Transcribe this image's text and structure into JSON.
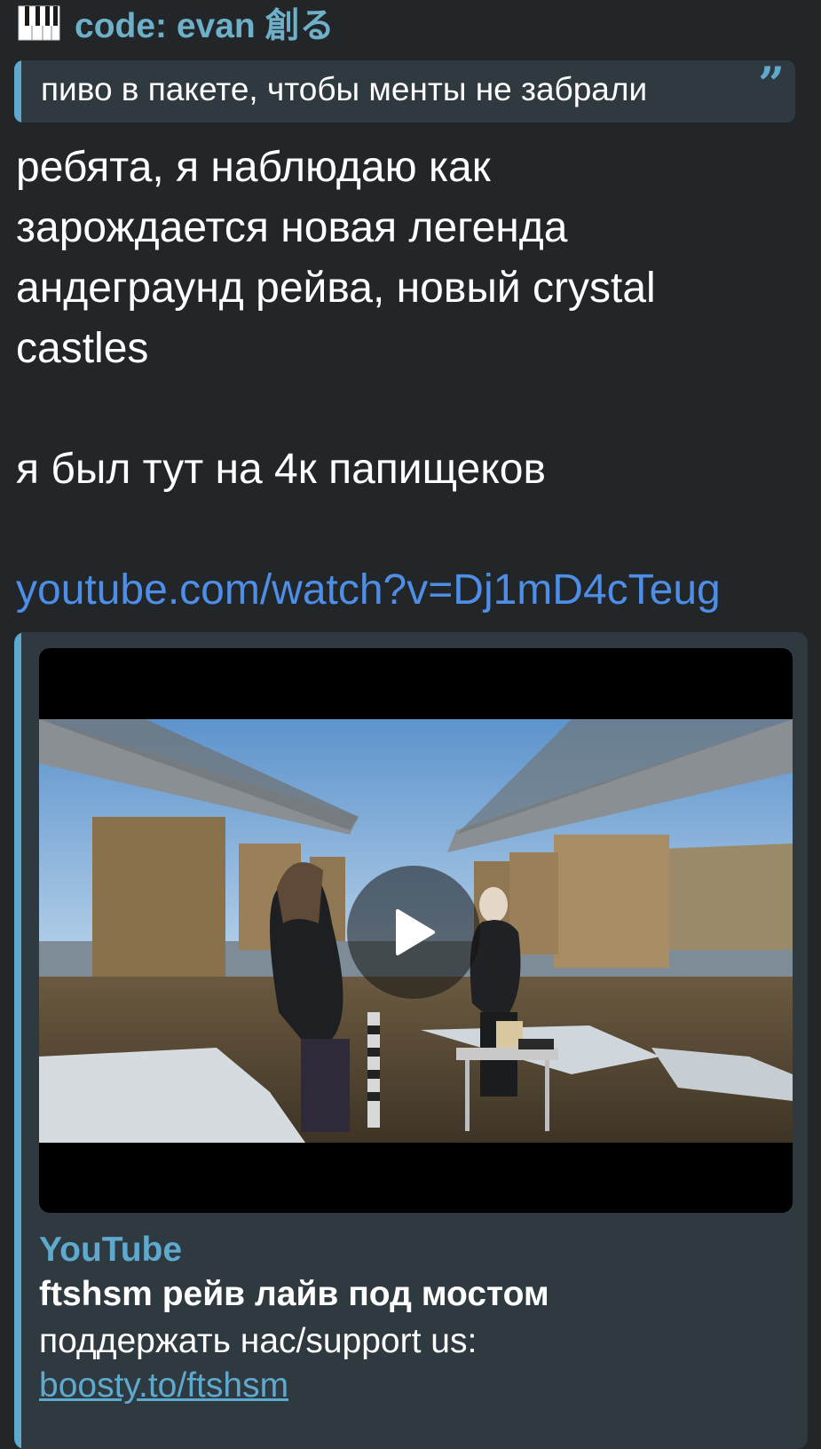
{
  "sender": {
    "name": "code: evan 創る",
    "icon": "piano-icon"
  },
  "reply": {
    "text": "пиво в пакете, чтобы менты не забрали",
    "icon": "quote-icon",
    "accent": "#5fa9cf"
  },
  "message": {
    "lines": [
      "ребята, я наблюдаю как",
      "зарождается новая легенда",
      "андеграунд рейва, новый crystal",
      "castles",
      "я был тут на 4к папищеков"
    ],
    "link": "youtube.com/watch?v=Dj1mD4cTeug"
  },
  "preview": {
    "site": "YouTube",
    "title": "ftshsm рейв лайв под мостом",
    "description": "поддержать нас/support us:",
    "description_link": "boosty.to/ftshsm",
    "play_icon": "play-icon"
  },
  "colors": {
    "background": "#232628",
    "bubble": "#2f3a40",
    "accent": "#5fa9cf",
    "link": "#4e8ee6"
  }
}
